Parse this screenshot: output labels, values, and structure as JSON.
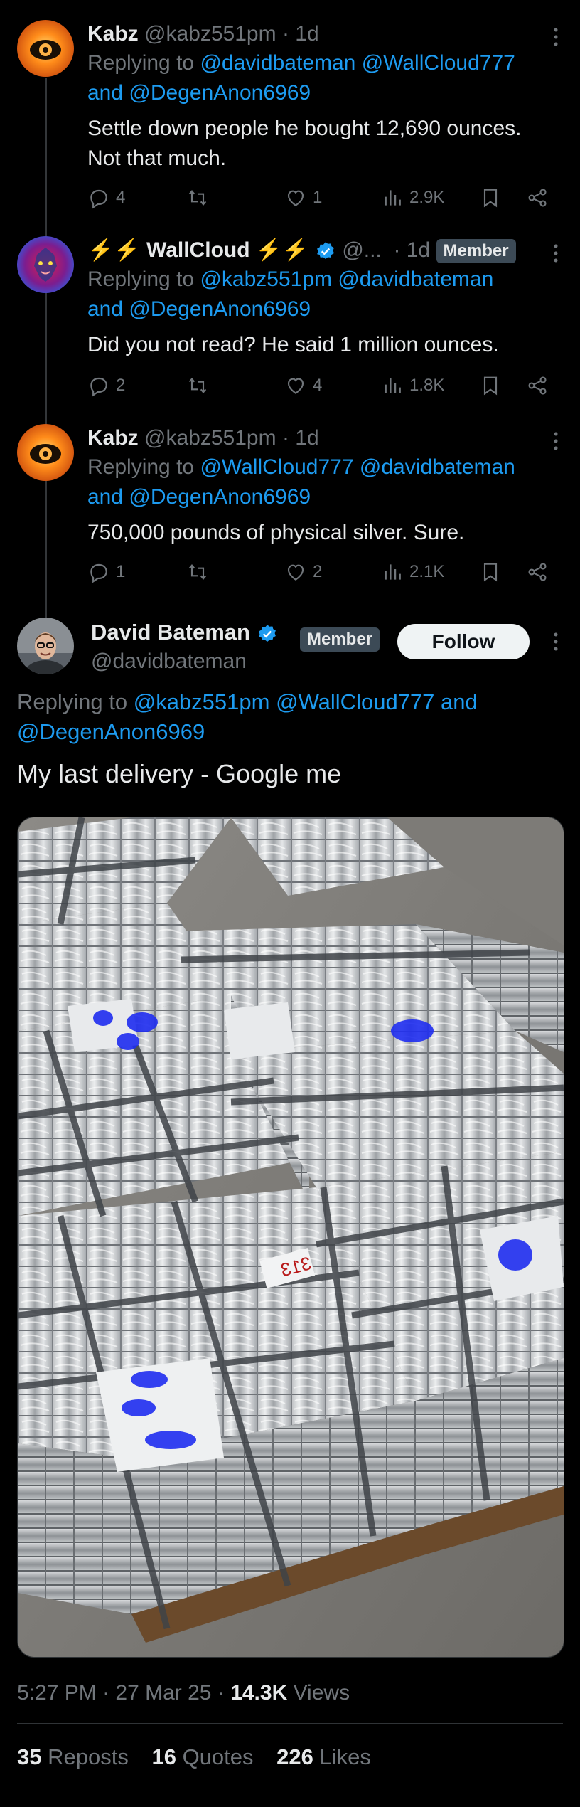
{
  "tweets": [
    {
      "name": "Kabz",
      "handle": "@kabz551pm",
      "time": "1d",
      "replying_label": "Replying to",
      "replying_a": "@davidbateman",
      "replying_b": "@WallCloud777",
      "replying_and": "and",
      "replying_c": "@DegenAnon6969",
      "text_l1": "Settle down people he bought 12,690 ounces.",
      "text_l2": "Not that much.",
      "replies": "4",
      "likes": "1",
      "views": "2.9K"
    },
    {
      "name": "⚡⚡ WallCloud ⚡⚡",
      "handle": "@...",
      "time": "1d",
      "badge": "Member",
      "replying_label": "Replying to",
      "replying_a": "@kabz551pm",
      "replying_b": "@davidbateman",
      "replying_and": "and",
      "replying_c": "@DegenAnon6969",
      "text_l1": "Did you not read?  He said 1 million ounces.",
      "replies": "2",
      "likes": "4",
      "views": "1.8K"
    },
    {
      "name": "Kabz",
      "handle": "@kabz551pm",
      "time": "1d",
      "replying_label": "Replying to",
      "replying_a": "@WallCloud777",
      "replying_b": "@davidbateman",
      "replying_and": "and",
      "replying_c": "@DegenAnon6969",
      "text_l1": "750,000 pounds of physical silver.   Sure.",
      "replies": "1",
      "likes": "2",
      "views": "2.1K"
    }
  ],
  "main": {
    "name": "David Bateman",
    "handle": "@davidbateman",
    "badge": "Member",
    "follow_label": "Follow",
    "replying_label": "Replying to",
    "replying_a": "@kabz551pm",
    "replying_b": "@WallCloud777",
    "replying_and": "and",
    "replying_c": "@DegenAnon6969",
    "text": "My last delivery - Google me",
    "photo_labels": [
      "313"
    ],
    "time": "5:27 PM",
    "date": "27 Mar 25",
    "views_count": "14.3K",
    "views_label": "Views",
    "reposts_count": "35",
    "reposts_label": "Reposts",
    "quotes_count": "16",
    "quotes_label": "Quotes",
    "likes_count": "226",
    "likes_label": "Likes"
  },
  "icons": {
    "reply": "reply-icon",
    "repost": "repost-icon",
    "like": "heart-icon",
    "views": "views-icon",
    "bookmark": "bookmark-icon",
    "share": "share-icon",
    "more": "more-icon",
    "verified": "verified-icon"
  },
  "colors": {
    "background": "#000000",
    "text": "#e7e9ea",
    "muted": "#71767b",
    "link": "#1d9bf0",
    "verified": "#1d9bf0",
    "badge_bg": "#3c4a56",
    "divider": "#2f3336"
  }
}
